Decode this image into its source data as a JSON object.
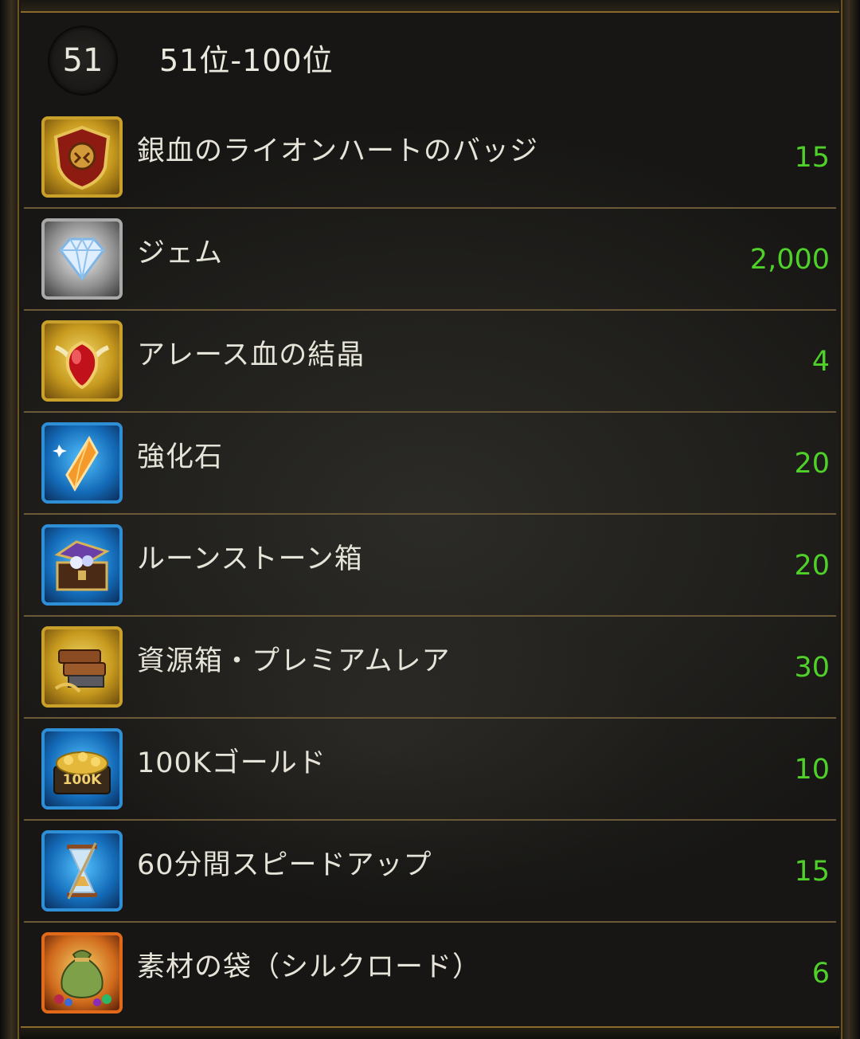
{
  "header": {
    "rank": "51",
    "title": "51位-100位"
  },
  "rewards": [
    {
      "name": "銀血のライオンハートのバッジ",
      "count": "15",
      "icon": "lionheart-badge-icon",
      "frame": "gold"
    },
    {
      "name": "ジェム",
      "count": "2,000",
      "icon": "gem-icon",
      "frame": "silver"
    },
    {
      "name": "アレース血の結晶",
      "count": "4",
      "icon": "ares-blood-crystal-icon",
      "frame": "gold"
    },
    {
      "name": "強化石",
      "count": "20",
      "icon": "enhancement-stone-icon",
      "frame": "blue"
    },
    {
      "name": "ルーンストーン箱",
      "count": "20",
      "icon": "runestone-chest-icon",
      "frame": "blue"
    },
    {
      "name": "資源箱・プレミアムレア",
      "count": "30",
      "icon": "resource-box-icon",
      "frame": "gold"
    },
    {
      "name": "100Kゴールド",
      "count": "10",
      "icon": "gold-coins-icon",
      "frame": "blue"
    },
    {
      "name": "60分間スピードアップ",
      "count": "15",
      "icon": "hourglass-icon",
      "frame": "blue"
    },
    {
      "name": "素材の袋（シルクロード）",
      "count": "6",
      "icon": "material-bag-icon",
      "frame": "orange"
    }
  ],
  "colors": {
    "count_text": "#4fd12a",
    "divider": "#6b5a37",
    "frame_accent": "#8a6a2a"
  }
}
